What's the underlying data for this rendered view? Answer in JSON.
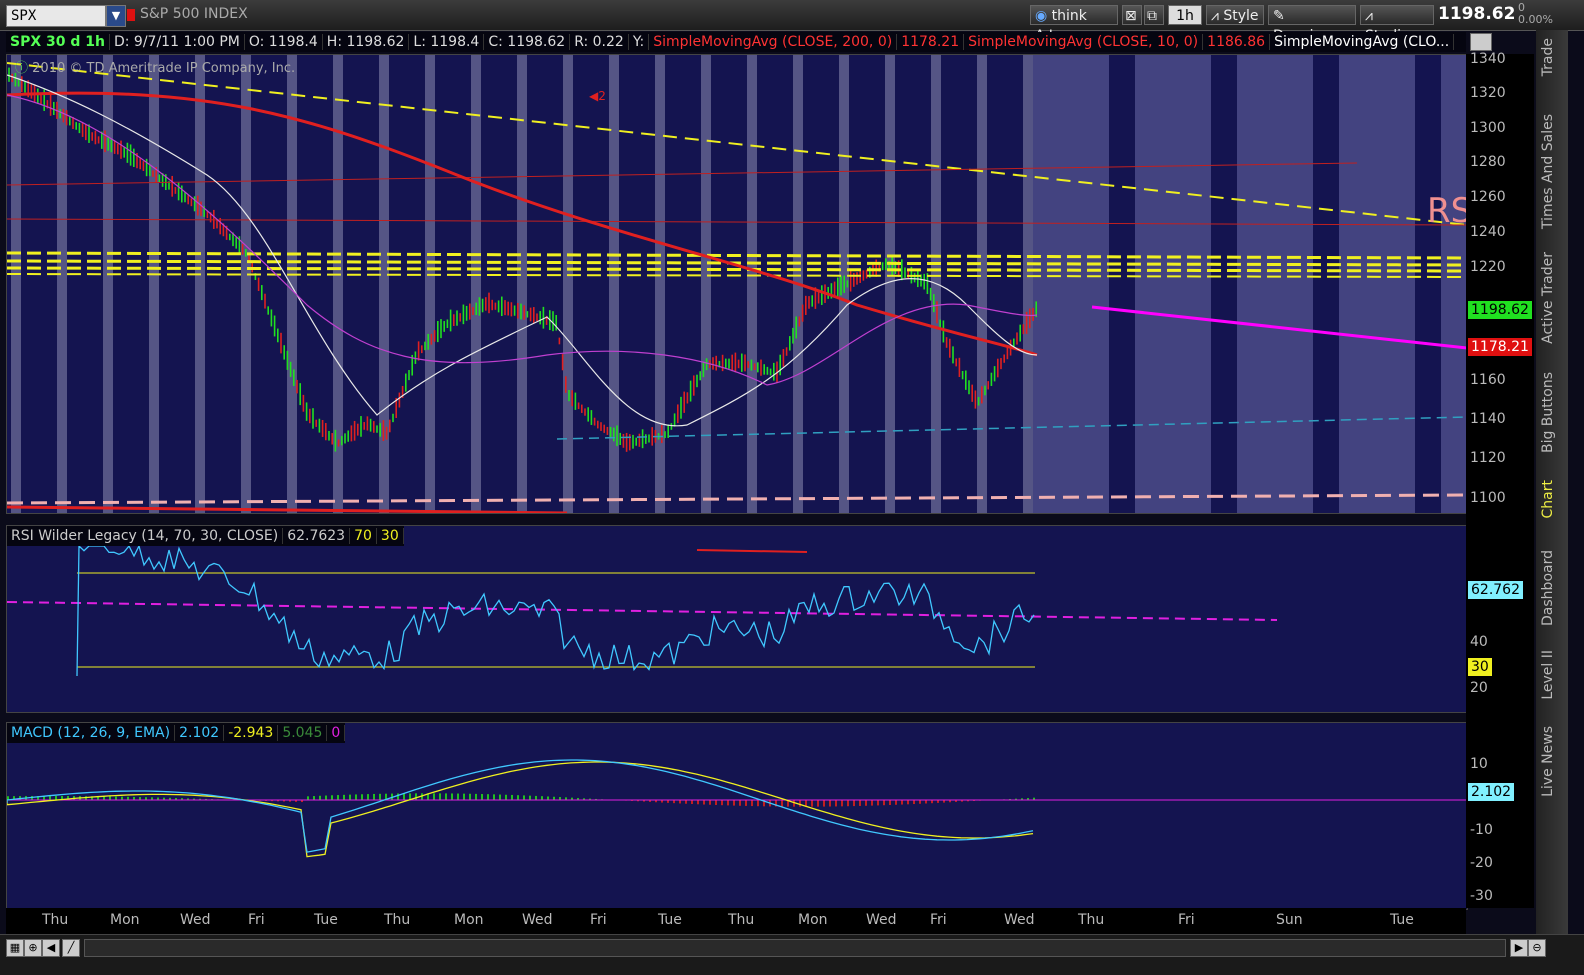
{
  "toolbar": {
    "symbol": "SPX",
    "index_name": "S&P 500 INDEX",
    "think_ai": "think A.I.",
    "timeframe": "1h",
    "style": "Style",
    "drawings": "Drawings",
    "studies": "Studies",
    "last_price": "1198.62",
    "change": "0",
    "change_pct": "0.00%"
  },
  "infobar": {
    "title": "SPX 30 d 1h",
    "date": "D: 9/7/11 1:00 PM",
    "open": "O: 1198.4",
    "high": "H: 1198.62",
    "low": "L: 1198.4",
    "close": "C: 1198.62",
    "range": "R: 0.22",
    "y": "Y:",
    "sma200": "SimpleMovingAvg (CLOSE, 200, 0)",
    "sma200_val": "1178.21",
    "sma10": "SimpleMovingAvg (CLOSE, 10, 0)",
    "sma10_val": "1186.86",
    "sma_more": "SimpleMovingAvg (CLO..."
  },
  "copyright": "2010 © TD Ameritrade IP Company, Inc.",
  "annotation_rs": "RS",
  "annotation_2": "2",
  "main_axis": {
    "ticks": [
      "1340",
      "1320",
      "1300",
      "1280",
      "1260",
      "1240",
      "1220",
      "1180",
      "1160",
      "1140",
      "1120",
      "1100"
    ],
    "last_badge": "1198.62",
    "sma_badge": "1178.21"
  },
  "rsi": {
    "label": "RSI Wilder Legacy (14, 70, 30, CLOSE)",
    "value": "62.7623",
    "ob": "70",
    "os": "30",
    "badge": "62.762",
    "ticks": [
      "40",
      "20"
    ],
    "os_badge": "30"
  },
  "macd": {
    "label": "MACD (12, 26, 9, EMA)",
    "value": "2.102",
    "avg": "-2.943",
    "diff": "5.045",
    "zero": "0",
    "badge": "2.102",
    "ticks": [
      "10",
      "-10",
      "-20",
      "-30"
    ]
  },
  "xaxis": [
    "Thu",
    "Mon",
    "Wed",
    "Fri",
    "Tue",
    "Thu",
    "Mon",
    "Wed",
    "Fri",
    "Tue",
    "Thu",
    "Mon",
    "Wed",
    "Fri",
    "Wed",
    "Thu",
    "Fri",
    "Sun",
    "Tue"
  ],
  "sidetabs": [
    "Trade",
    "Times And Sales",
    "Active Trader",
    "Big Buttons",
    "Chart",
    "Dashboard",
    "Level II",
    "Live News"
  ],
  "colors": {
    "panel_bg": "#141450",
    "sma200": "#e02020",
    "trend_yellow": "#f0f020",
    "trend_magenta": "#ff00ff",
    "rsi_line": "#40c8ff",
    "macd_line": "#40c8ff",
    "signal_line": "#f0f020"
  }
}
